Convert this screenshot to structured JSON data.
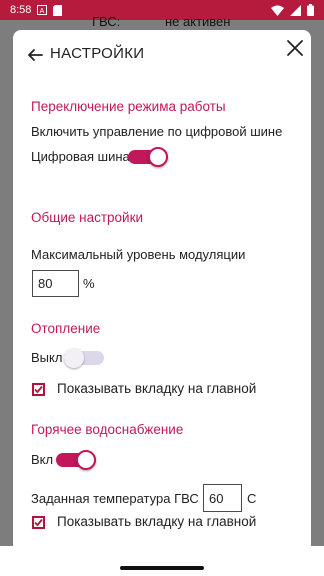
{
  "status_bar": {
    "time": "8:58",
    "notif_a": "A",
    "background": "#b61a3c"
  },
  "background_row": {
    "label": "ГВС:",
    "value": "не активен"
  },
  "dialog": {
    "title": "НАСТРОЙКИ",
    "accent": "#c2185b",
    "mode_section": {
      "title": "Переключение режима работы",
      "description": "Включить управление по цифровой шине",
      "toggle_label": "Цифровая шина",
      "toggle_on": true
    },
    "general_section": {
      "title": "Общие настройки",
      "modulation_label": "Максимальный уровень модуляции",
      "modulation_value": "80",
      "modulation_unit": "%"
    },
    "heating_section": {
      "title": "Отопление",
      "toggle_label": "Выкл",
      "toggle_on": false,
      "show_tab_label": "Показывать вкладку на главной",
      "show_tab_checked": true
    },
    "hot_water_section": {
      "title": "Горячее водоснабжение",
      "toggle_label": "Вкл",
      "toggle_on": true,
      "temp_label": "Заданная температура ГВС",
      "temp_value": "60",
      "temp_unit": "С",
      "show_tab_label": "Показывать вкладку на главной",
      "show_tab_checked": true
    }
  }
}
